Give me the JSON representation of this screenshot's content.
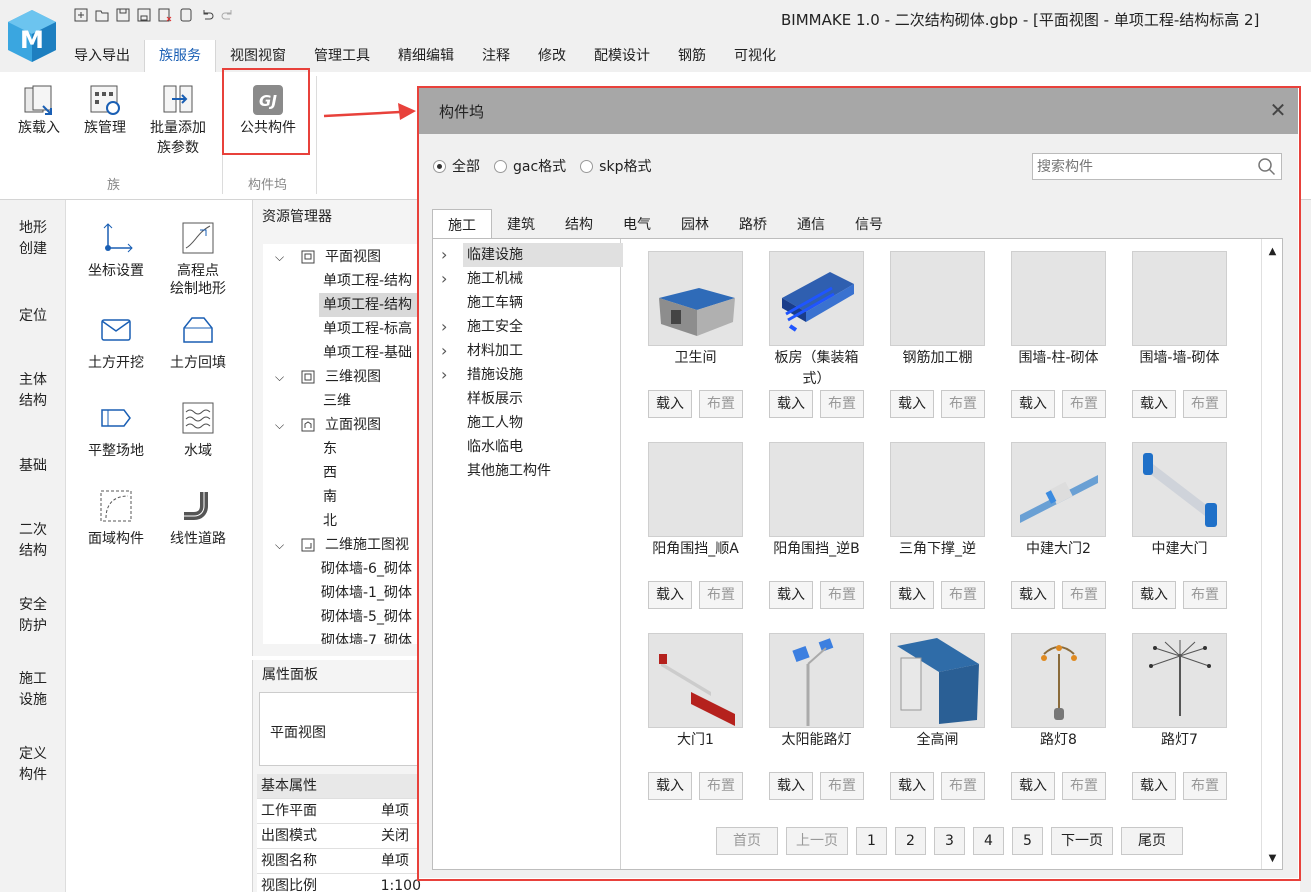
{
  "window": {
    "title": "BIMMAKE 1.0 - 二次结构砌体.gbp - [平面视图 - 单项工程-结构标高 2]"
  },
  "menu": [
    "导入导出",
    "族服务",
    "视图视窗",
    "管理工具",
    "精细编辑",
    "注释",
    "修改",
    "配模设计",
    "钢筋",
    "可视化"
  ],
  "menu_active": 1,
  "ribbon": {
    "family_load": "族载入",
    "family_manage": "族管理",
    "batch_add_1": "批量添加",
    "batch_add_2": "族参数",
    "public_component": "公共构件",
    "group_family": "族",
    "group_dock": "构件坞"
  },
  "vtabs": [
    [
      "地形",
      "创建"
    ],
    [
      "定位"
    ],
    [
      "主体",
      "结构"
    ],
    [
      "基础"
    ],
    [
      "二次",
      "结构"
    ],
    [
      "安全",
      "防护"
    ],
    [
      "施工",
      "设施"
    ],
    [
      "定义",
      "构件"
    ]
  ],
  "tools": {
    "coord": "坐标设置",
    "elev_1": "高程点",
    "elev_2": "绘制地形",
    "excavate": "土方开挖",
    "backfill": "土方回填",
    "level_site": "平整场地",
    "water": "水域",
    "area_comp": "面域构件",
    "linear_road": "线性道路"
  },
  "resource_manager": {
    "title": "资源管理器",
    "rows": [
      "平面视图",
      "单项工程-结构",
      "单项工程-结构",
      "单项工程-标高",
      "单项工程-基础",
      "三维视图",
      "三维",
      "立面视图",
      "东",
      "西",
      "南",
      "北",
      "二维施工图视",
      "砌体墙-6_砌体",
      "砌体墙-1_砌体",
      "砌体墙-5_砌体",
      "砌体墙-7_砌体"
    ]
  },
  "properties": {
    "title": "属性面板",
    "view_name": "平面视图",
    "header": "基本属性",
    "rows": [
      [
        "工作平面",
        "单项"
      ],
      [
        "出图模式",
        "关闭"
      ],
      [
        "视图名称",
        "单项"
      ],
      [
        "视图比例",
        "1:100"
      ]
    ]
  },
  "dialog": {
    "title": "构件坞",
    "filters": [
      "全部",
      "gac格式",
      "skp格式"
    ],
    "filter_selected": 0,
    "search_placeholder": "搜索构件",
    "tabs": [
      "施工",
      "建筑",
      "结构",
      "电气",
      "园林",
      "路桥",
      "通信",
      "信号"
    ],
    "tab_active": 0,
    "categories": [
      {
        "label": "临建设施",
        "expandable": true,
        "selected": true
      },
      {
        "label": "施工机械",
        "expandable": true
      },
      {
        "label": "施工车辆",
        "expandable": false
      },
      {
        "label": "施工安全",
        "expandable": true
      },
      {
        "label": "材料加工",
        "expandable": true
      },
      {
        "label": "措施设施",
        "expandable": true
      },
      {
        "label": "样板展示",
        "expandable": false
      },
      {
        "label": "施工人物",
        "expandable": false
      },
      {
        "label": "临水临电",
        "expandable": false
      },
      {
        "label": "其他施工构件",
        "expandable": false
      }
    ],
    "items": [
      {
        "name": "卫生间",
        "thumb": "toilet"
      },
      {
        "name": "板房（集装箱式）",
        "thumb": "container"
      },
      {
        "name": "钢筋加工棚",
        "thumb": "blank"
      },
      {
        "name": "围墙-柱-砌体",
        "thumb": "blank"
      },
      {
        "name": "围墙-墙-砌体",
        "thumb": "blank"
      },
      {
        "name": "阳角围挡_顺A",
        "thumb": "blank"
      },
      {
        "name": "阳角围挡_逆B",
        "thumb": "blank"
      },
      {
        "name": "三角下撑_逆",
        "thumb": "blank"
      },
      {
        "name": "中建大门2",
        "thumb": "gate2"
      },
      {
        "name": "中建大门",
        "thumb": "gate"
      },
      {
        "name": "大门1",
        "thumb": "gate1"
      },
      {
        "name": "太阳能路灯",
        "thumb": "solar"
      },
      {
        "name": "全高闸",
        "thumb": "turnstile"
      },
      {
        "name": "路灯8",
        "thumb": "lamp8"
      },
      {
        "name": "路灯7",
        "thumb": "lamp7"
      }
    ],
    "load_label": "载入",
    "place_label": "布置",
    "pager": {
      "first": "首页",
      "prev": "上一页",
      "pages": [
        "1",
        "2",
        "3",
        "4",
        "5"
      ],
      "next": "下一页",
      "last": "尾页"
    }
  },
  "colors": {
    "accent": "#1a5fb4",
    "highlight": "#e8413b",
    "dialog_title": "#a7a7a7"
  }
}
